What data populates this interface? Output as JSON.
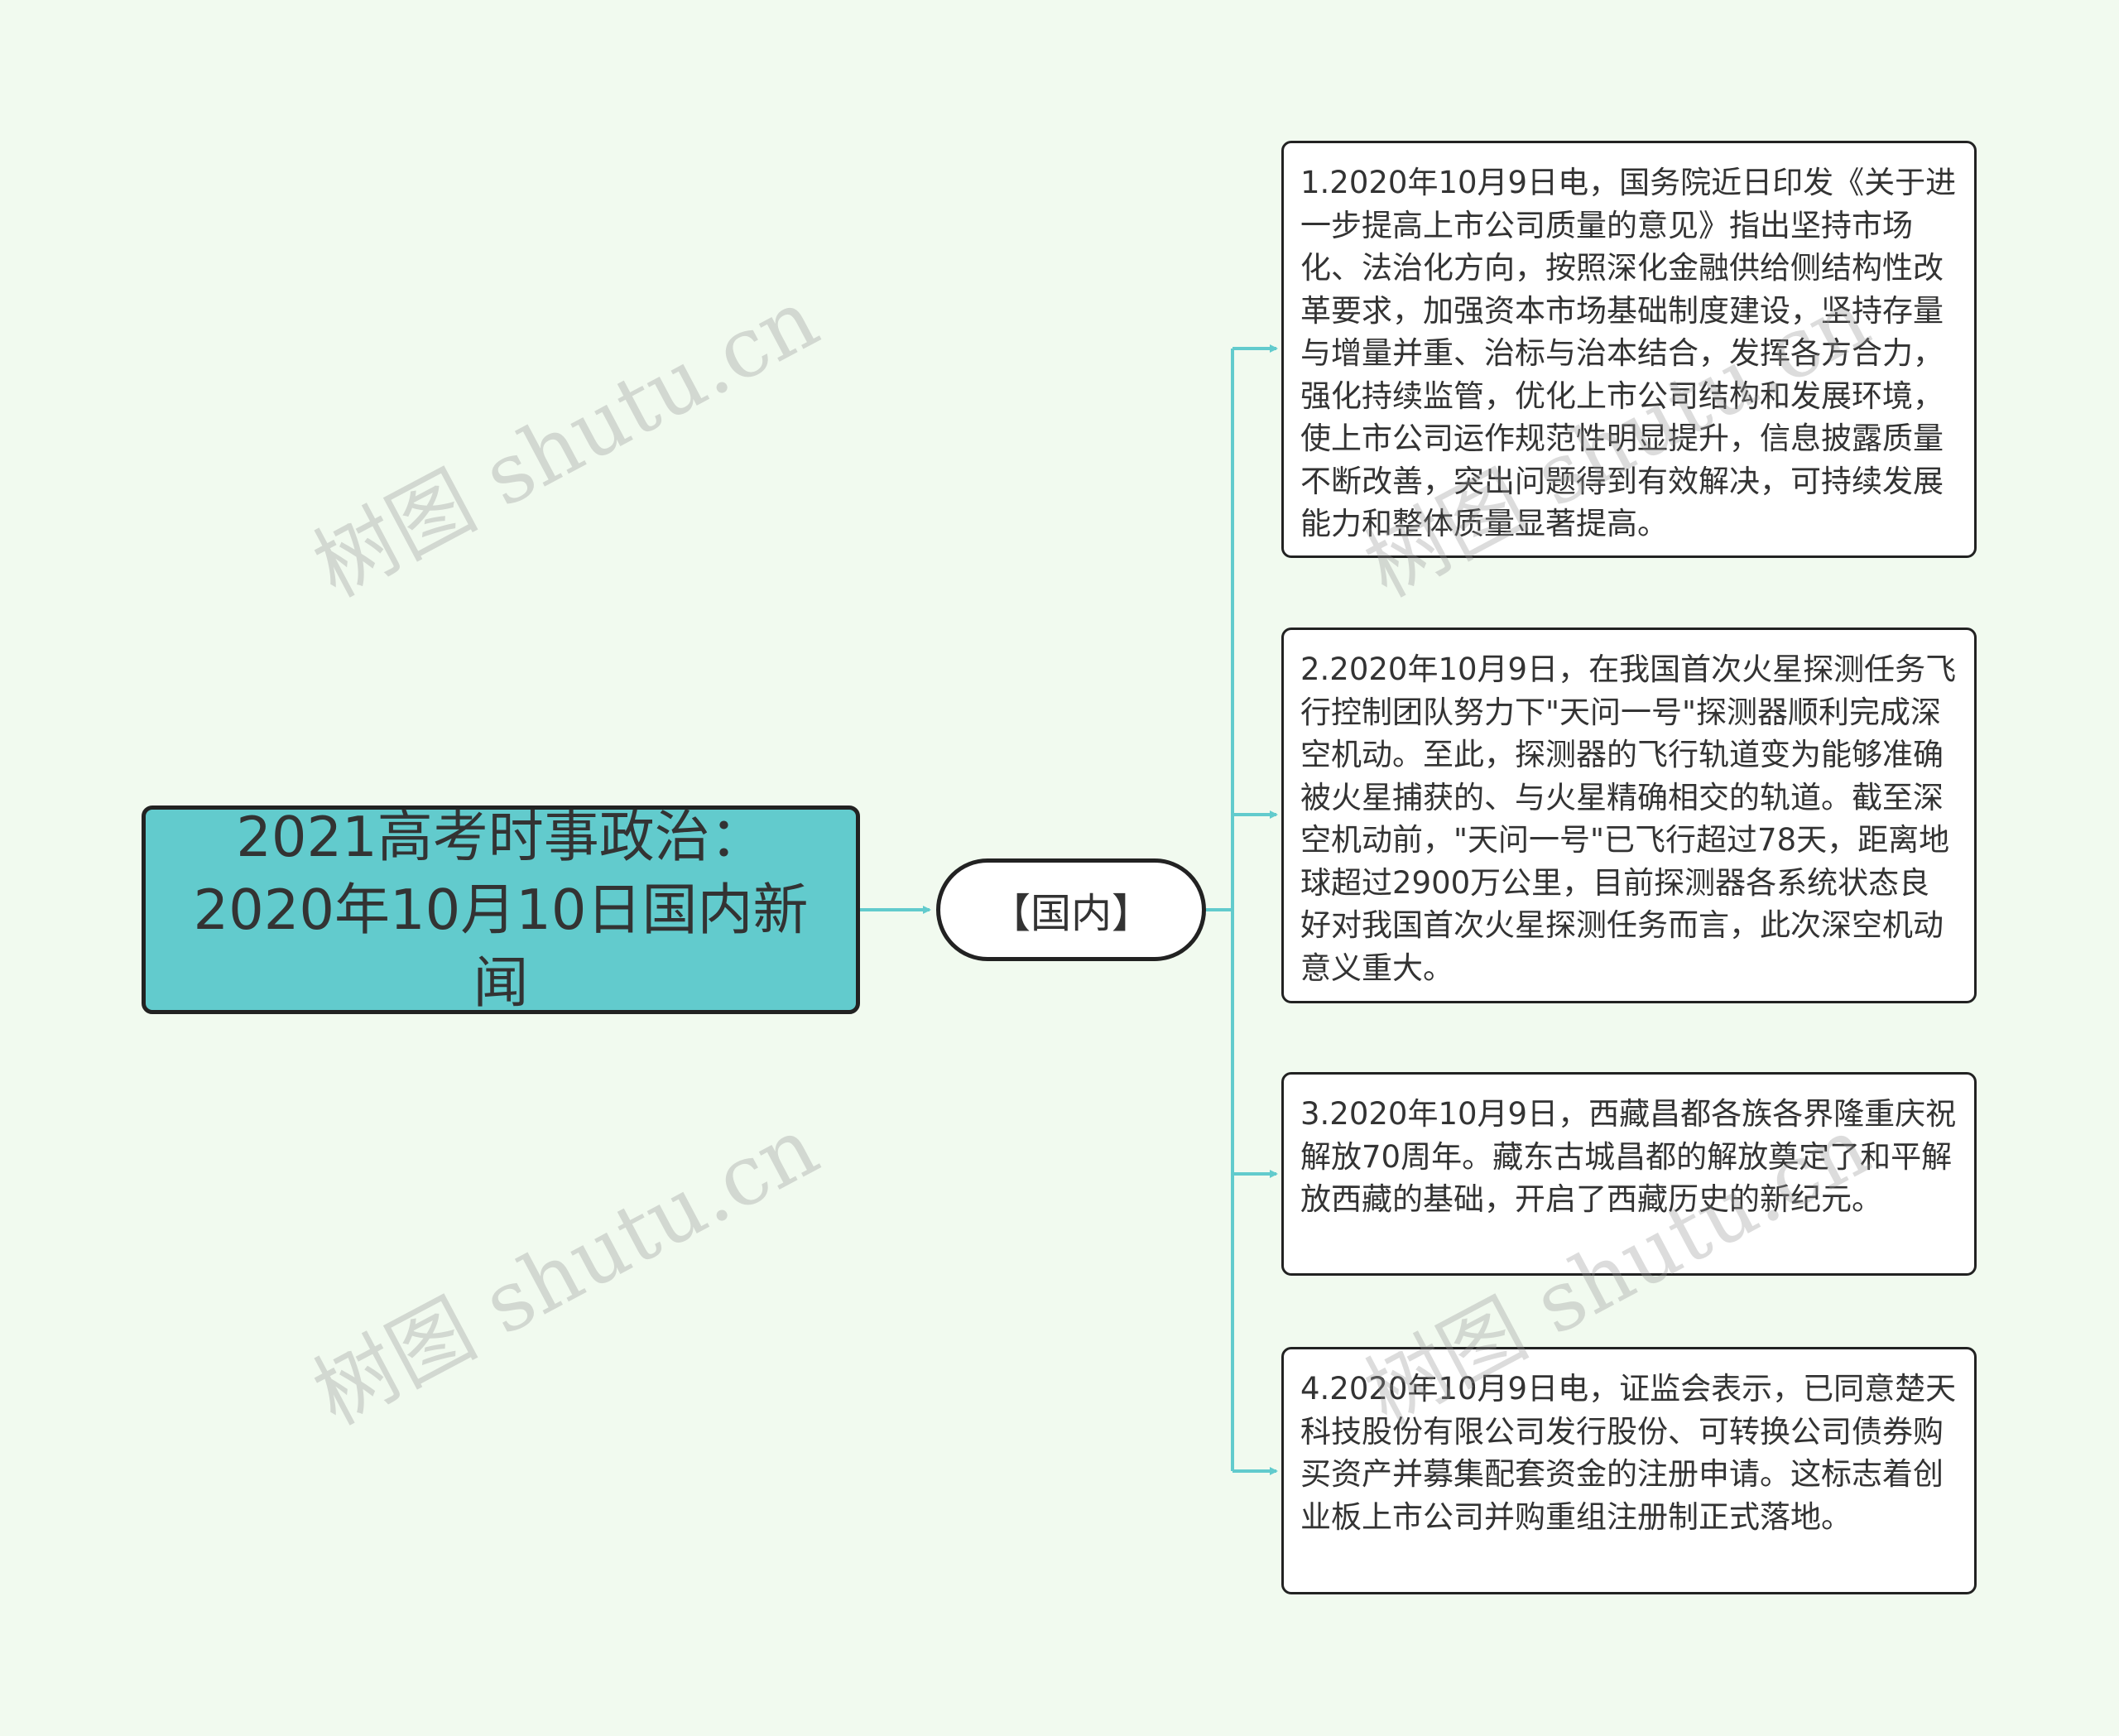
{
  "watermark_text": "树图 shutu.cn",
  "colors": {
    "background": "#f1faef",
    "root_fill": "#62cbcd",
    "connector": "#62cbcd",
    "border": "#222222"
  },
  "root": {
    "title": "2021高考时事政治：2020年10月10日国内新闻"
  },
  "branch": {
    "label": "【国内】"
  },
  "leaves": [
    {
      "text": "1.2020年10月9日电，国务院近日印发《关于进一步提高上市公司质量的意见》指出坚持市场化、法治化方向，按照深化金融供给侧结构性改革要求，加强资本市场基础制度建设，坚持存量与增量并重、治标与治本结合，发挥各方合力，强化持续监管，优化上市公司结构和发展环境，使上市公司运作规范性明显提升，信息披露质量不断改善，突出问题得到有效解决，可持续发展能力和整体质量显著提高。"
    },
    {
      "text": "2.2020年10月9日，在我国首次火星探测任务飞行控制团队努力下\"天问一号\"探测器顺利完成深空机动。至此，探测器的飞行轨道变为能够准确被火星捕获的、与火星精确相交的轨道。截至深空机动前，\"天问一号\"已飞行超过78天，距离地球超过2900万公里，目前探测器各系统状态良好对我国首次火星探测任务而言，此次深空机动意义重大。"
    },
    {
      "text": "3.2020年10月9日，西藏昌都各族各界隆重庆祝解放70周年。藏东古城昌都的解放奠定了和平解放西藏的基础，开启了西藏历史的新纪元。"
    },
    {
      "text": "4.2020年10月9日电，证监会表示，已同意楚天科技股份有限公司发行股份、可转换公司债券购买资产并募集配套资金的注册申请。这标志着创业板上市公司并购重组注册制正式落地。"
    }
  ]
}
